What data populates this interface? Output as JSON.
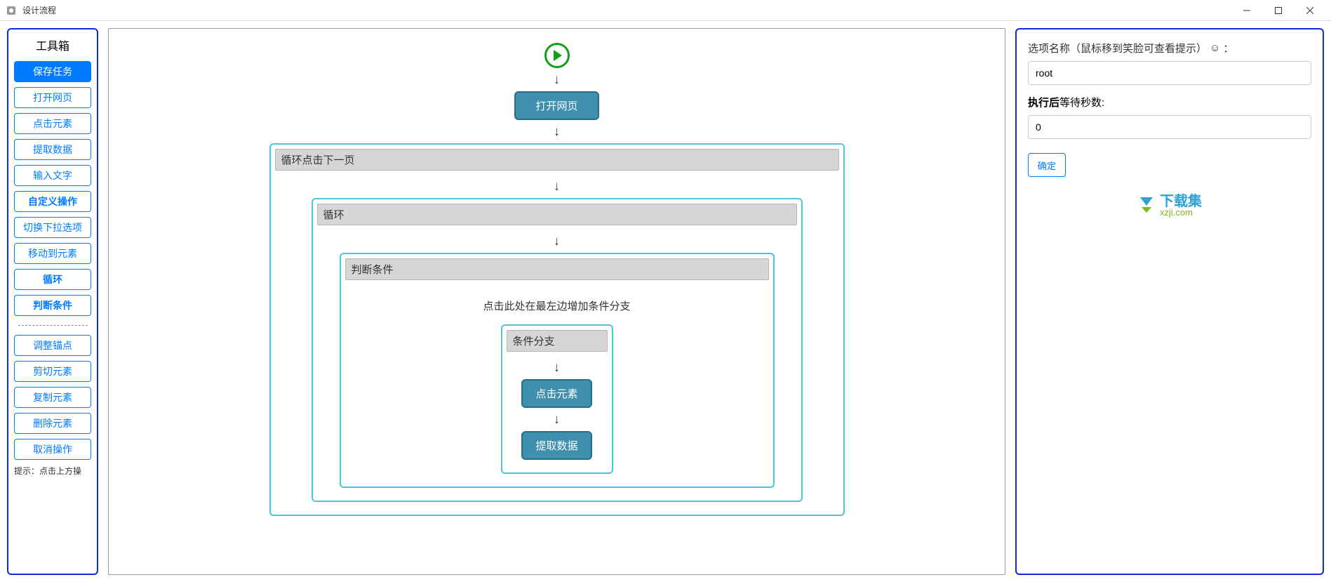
{
  "window": {
    "title": "设计流程"
  },
  "toolbox": {
    "title": "工具箱",
    "buttons": {
      "save": "保存任务",
      "open_page": "打开网页",
      "click_element": "点击元素",
      "extract_data": "提取数据",
      "input_text": "输入文字",
      "custom_action": "自定义操作",
      "switch_dropdown": "切换下拉选项",
      "move_to_element": "移动到元素",
      "loop": "循环",
      "condition": "判断条件",
      "adjust_anchor": "调整锚点",
      "cut_element": "剪切元素",
      "copy_element": "复制元素",
      "delete_element": "删除元素",
      "cancel_action": "取消操作"
    },
    "hint": "提示：点击上方操"
  },
  "canvas": {
    "nodes": {
      "open_page": "打开网页",
      "loop_next": "循环点击下一页",
      "loop_inner": "循环",
      "condition": "判断条件",
      "branch_hint": "点击此处在最左边增加条件分支",
      "branch": "条件分支",
      "click_element": "点击元素",
      "extract_data": "提取数据"
    }
  },
  "panel": {
    "name_label": "选项名称（鼠标移到笑脸可查看提示）",
    "name_value": "root",
    "wait_label_bold": "执行后",
    "wait_label_rest": "等待秒数:",
    "wait_value": "0",
    "confirm": "确定",
    "watermark_text1": "下载集",
    "watermark_text2": "xzji.com"
  }
}
